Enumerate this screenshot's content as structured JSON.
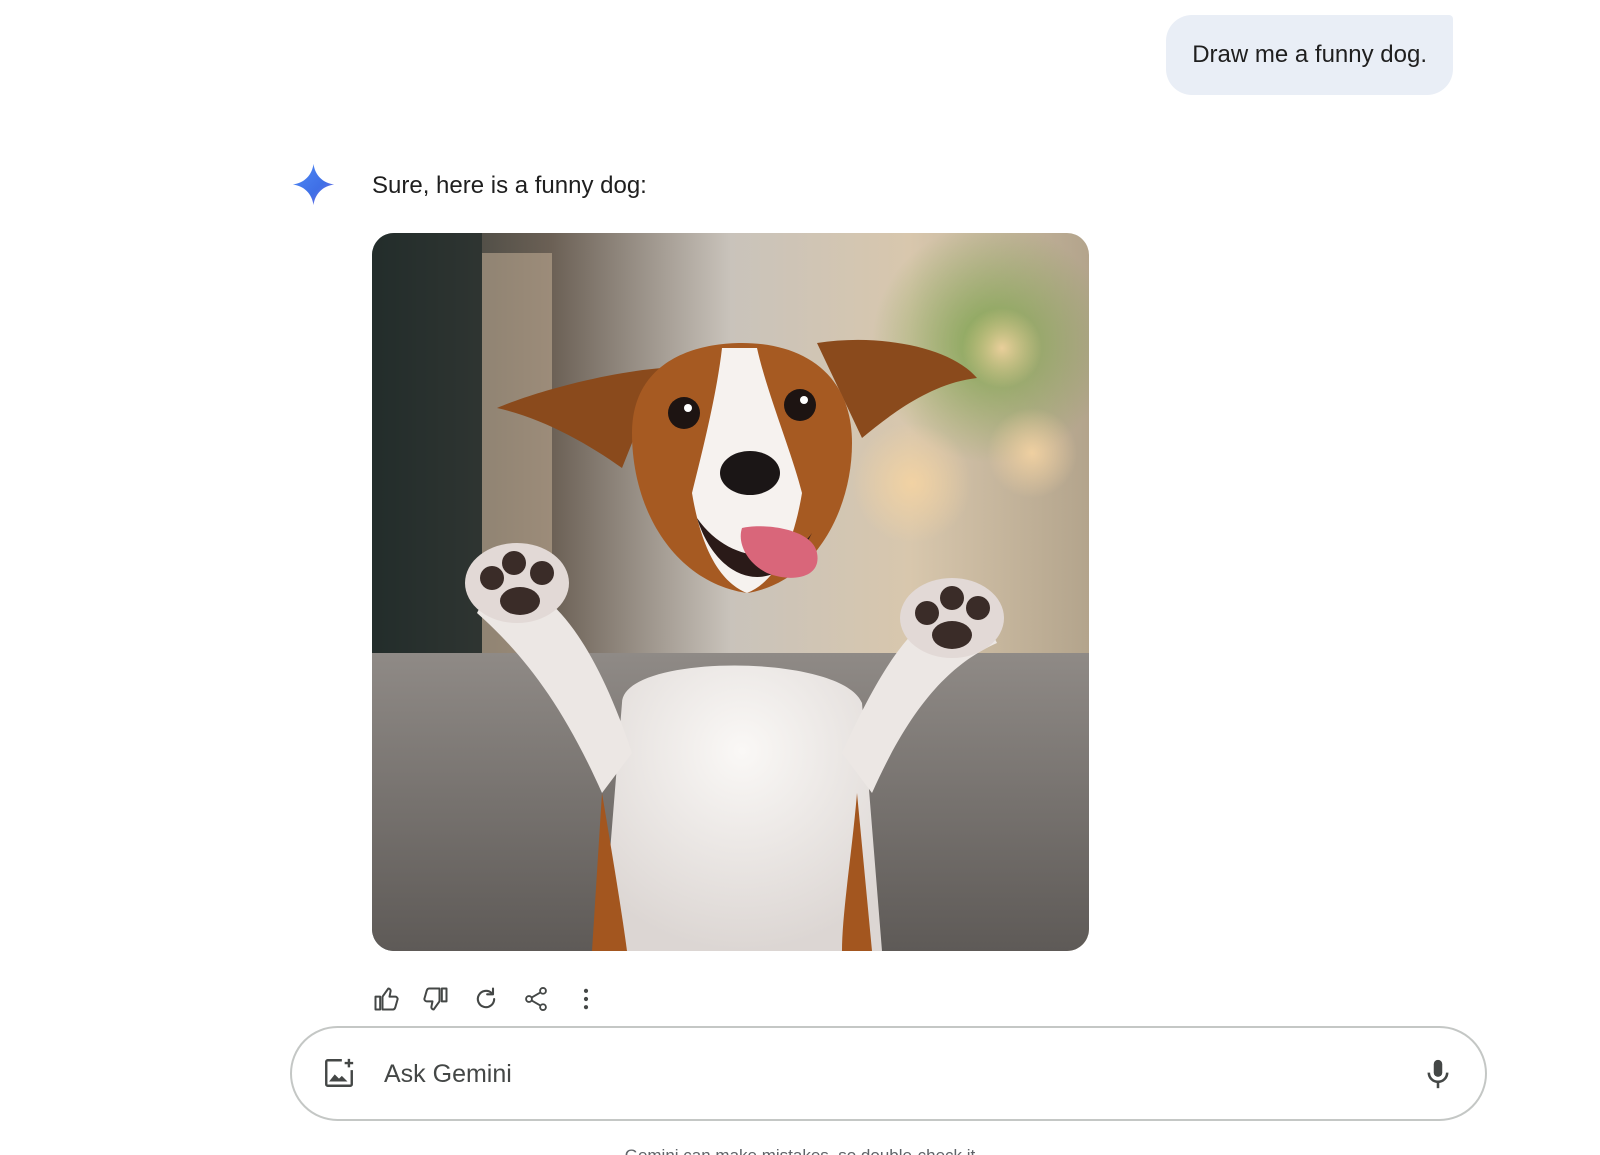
{
  "conversation": {
    "user_prompt": "Draw me a funny dog.",
    "response_text": "Sure, here is a funny dog:"
  },
  "input": {
    "placeholder": "Ask Gemini"
  },
  "footer": {
    "disclaimer": "Gemini can make mistakes, so double-check it"
  },
  "icons": {
    "logo": "gemini-sparkle-icon",
    "actions": [
      "thumbs-up-icon",
      "thumbs-down-icon",
      "regenerate-icon",
      "share-icon",
      "more-vert-icon"
    ],
    "upload": "image-upload-icon",
    "mic": "mic-icon"
  },
  "colors": {
    "bubble_bg": "#e9eef6",
    "accent_blue": "#4285f4",
    "icon_gray": "#444746"
  }
}
